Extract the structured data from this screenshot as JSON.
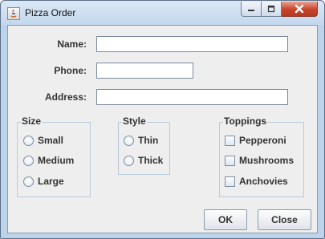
{
  "window": {
    "title": "Pizza Order",
    "buttons": {
      "minimize": "minimize-icon",
      "maximize": "maximize-icon",
      "close": "close-icon"
    },
    "colors": {
      "frame": "#bcd3ea",
      "close": "#c7432b",
      "client": "#eeeeee"
    }
  },
  "form": {
    "name_label": "Name:",
    "name_value": "",
    "phone_label": "Phone:",
    "phone_value": "",
    "address_label": "Address:",
    "address_value": ""
  },
  "size": {
    "title": "Size",
    "options": [
      "Small",
      "Medium",
      "Large"
    ]
  },
  "style": {
    "title": "Style",
    "options": [
      "Thin",
      "Thick"
    ]
  },
  "toppings": {
    "title": "Toppings",
    "options": [
      "Pepperoni",
      "Mushrooms",
      "Anchovies"
    ]
  },
  "actions": {
    "ok_label": "OK",
    "close_label": "Close"
  }
}
